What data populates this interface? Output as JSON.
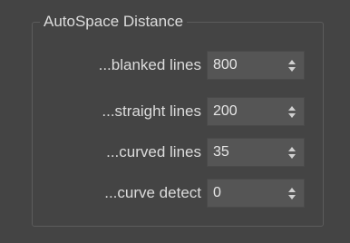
{
  "group": {
    "title": "AutoSpace Distance"
  },
  "rows": [
    {
      "label": "...blanked lines",
      "value": "800"
    },
    {
      "label": "...straight lines",
      "value": "200"
    },
    {
      "label": "...curved lines",
      "value": "35"
    },
    {
      "label": "...curve detect",
      "value": "0"
    }
  ],
  "icons": {
    "spinner": "spinner-up-down-icon"
  }
}
